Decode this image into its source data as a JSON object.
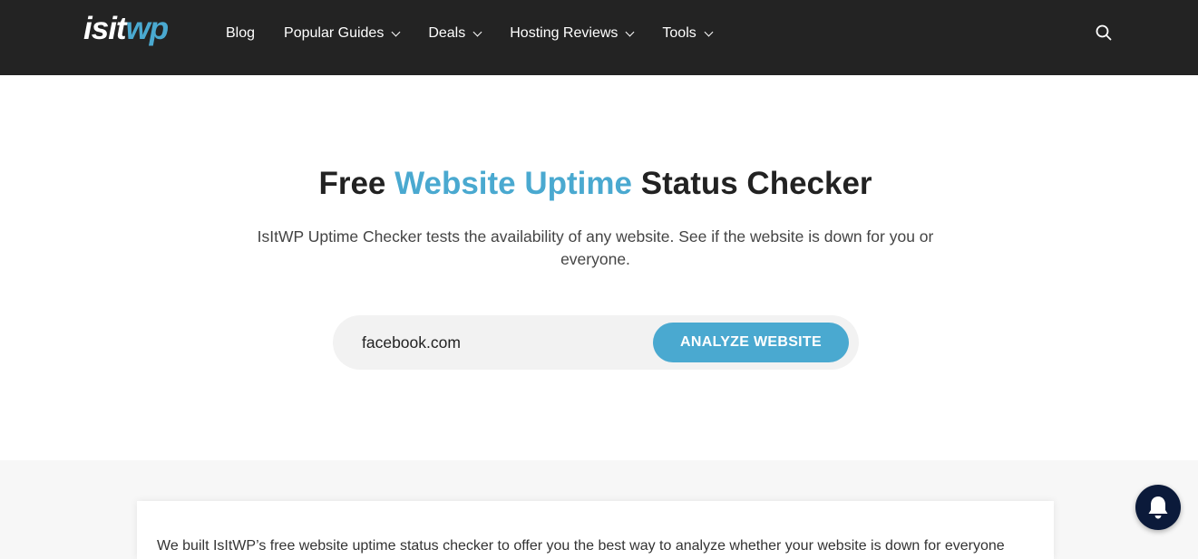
{
  "header": {
    "logo_part1": "isit",
    "logo_part2": "wp",
    "nav": [
      {
        "label": "Blog",
        "has_dropdown": false
      },
      {
        "label": "Popular Guides",
        "has_dropdown": true
      },
      {
        "label": "Deals",
        "has_dropdown": true
      },
      {
        "label": "Hosting Reviews",
        "has_dropdown": true
      },
      {
        "label": "Tools",
        "has_dropdown": true
      }
    ],
    "search_icon": "search-icon"
  },
  "hero": {
    "title_pre": "Free ",
    "title_highlight": "Website Uptime",
    "title_post": " Status Checker",
    "description": "IsItWP Uptime Checker tests the availability of any website. See if the website is down for you or everyone."
  },
  "checker": {
    "url_value": "facebook.com",
    "button_label": "ANALYZE WEBSITE"
  },
  "content": {
    "intro": "We built IsItWP’s free website uptime status checker to offer you the best way to analyze whether your website is down for everyone"
  },
  "notification": {
    "icon": "bell-icon"
  },
  "colors": {
    "header_bg": "#232323",
    "accent": "#4aa9d0",
    "bell_bg": "#0b1a3a"
  }
}
